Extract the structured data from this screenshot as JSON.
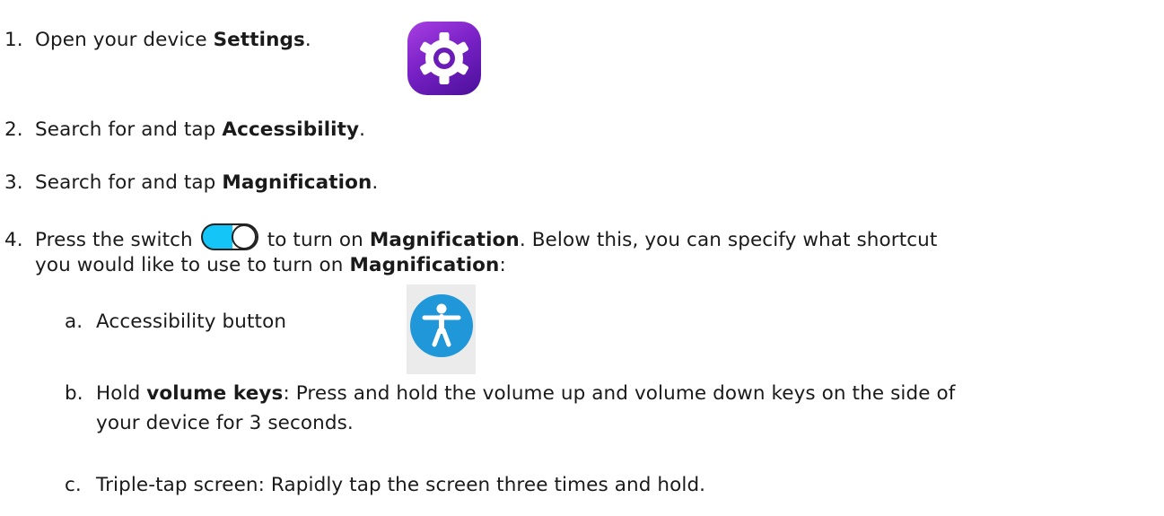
{
  "steps": [
    {
      "num": "1.",
      "pre": "Open your device ",
      "bold": "Settings",
      "post": "."
    },
    {
      "num": "2.",
      "pre": "Search for and tap ",
      "bold": "Accessibility",
      "post": "."
    },
    {
      "num": "3.",
      "pre": "Search for and tap ",
      "bold": "Magnification",
      "post": "."
    },
    {
      "num": "4.",
      "pre": "Press the switch",
      "mid": "to turn on ",
      "bold": "Magnification",
      "post": ". Below this, you can specify what shortcut",
      "line2_pre": "you would like to use to turn on ",
      "line2_bold": "Magnification",
      "line2_post": ":"
    }
  ],
  "substeps": [
    {
      "letter": "a.",
      "text": "Accessibility button"
    },
    {
      "letter": "b.",
      "pre": "Hold ",
      "bold": "volume keys",
      "post": ": Press and hold the volume up and volume down keys on the side of",
      "line2": "your device for 3 seconds."
    },
    {
      "letter": "c.",
      "text": "Triple-tap screen: Rapidly tap the screen three times and hold."
    }
  ],
  "icons": {
    "settings": "gear-icon",
    "toggle": "toggle-switch-on",
    "accessibility": "accessibility-person-icon"
  },
  "colors": {
    "text": "#1a1a1a",
    "settings_gradient_start": "#a83fe2",
    "settings_gradient_end": "#4a0f99",
    "toggle_on": "#13c6f7",
    "accessibility_blue": "#1f97d8",
    "accessibility_tile": "#ebebeb"
  }
}
